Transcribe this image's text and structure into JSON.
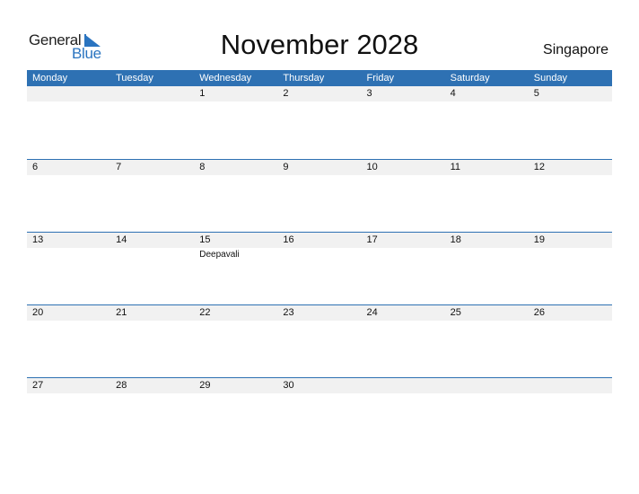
{
  "logo": {
    "word1": "General",
    "word2": "Blue"
  },
  "title": "November 2028",
  "country": "Singapore",
  "weekdays": [
    "Monday",
    "Tuesday",
    "Wednesday",
    "Thursday",
    "Friday",
    "Saturday",
    "Sunday"
  ],
  "weeks": [
    [
      {
        "d": ""
      },
      {
        "d": ""
      },
      {
        "d": "1"
      },
      {
        "d": "2"
      },
      {
        "d": "3"
      },
      {
        "d": "4"
      },
      {
        "d": "5"
      }
    ],
    [
      {
        "d": "6"
      },
      {
        "d": "7"
      },
      {
        "d": "8"
      },
      {
        "d": "9"
      },
      {
        "d": "10"
      },
      {
        "d": "11"
      },
      {
        "d": "12"
      }
    ],
    [
      {
        "d": "13"
      },
      {
        "d": "14"
      },
      {
        "d": "15",
        "e": "Deepavali"
      },
      {
        "d": "16"
      },
      {
        "d": "17"
      },
      {
        "d": "18"
      },
      {
        "d": "19"
      }
    ],
    [
      {
        "d": "20"
      },
      {
        "d": "21"
      },
      {
        "d": "22"
      },
      {
        "d": "23"
      },
      {
        "d": "24"
      },
      {
        "d": "25"
      },
      {
        "d": "26"
      }
    ],
    [
      {
        "d": "27"
      },
      {
        "d": "28"
      },
      {
        "d": "29"
      },
      {
        "d": "30"
      },
      {
        "d": ""
      },
      {
        "d": ""
      },
      {
        "d": ""
      }
    ]
  ],
  "colors": {
    "accent": "#2e71b3",
    "band": "#f1f1f1"
  }
}
